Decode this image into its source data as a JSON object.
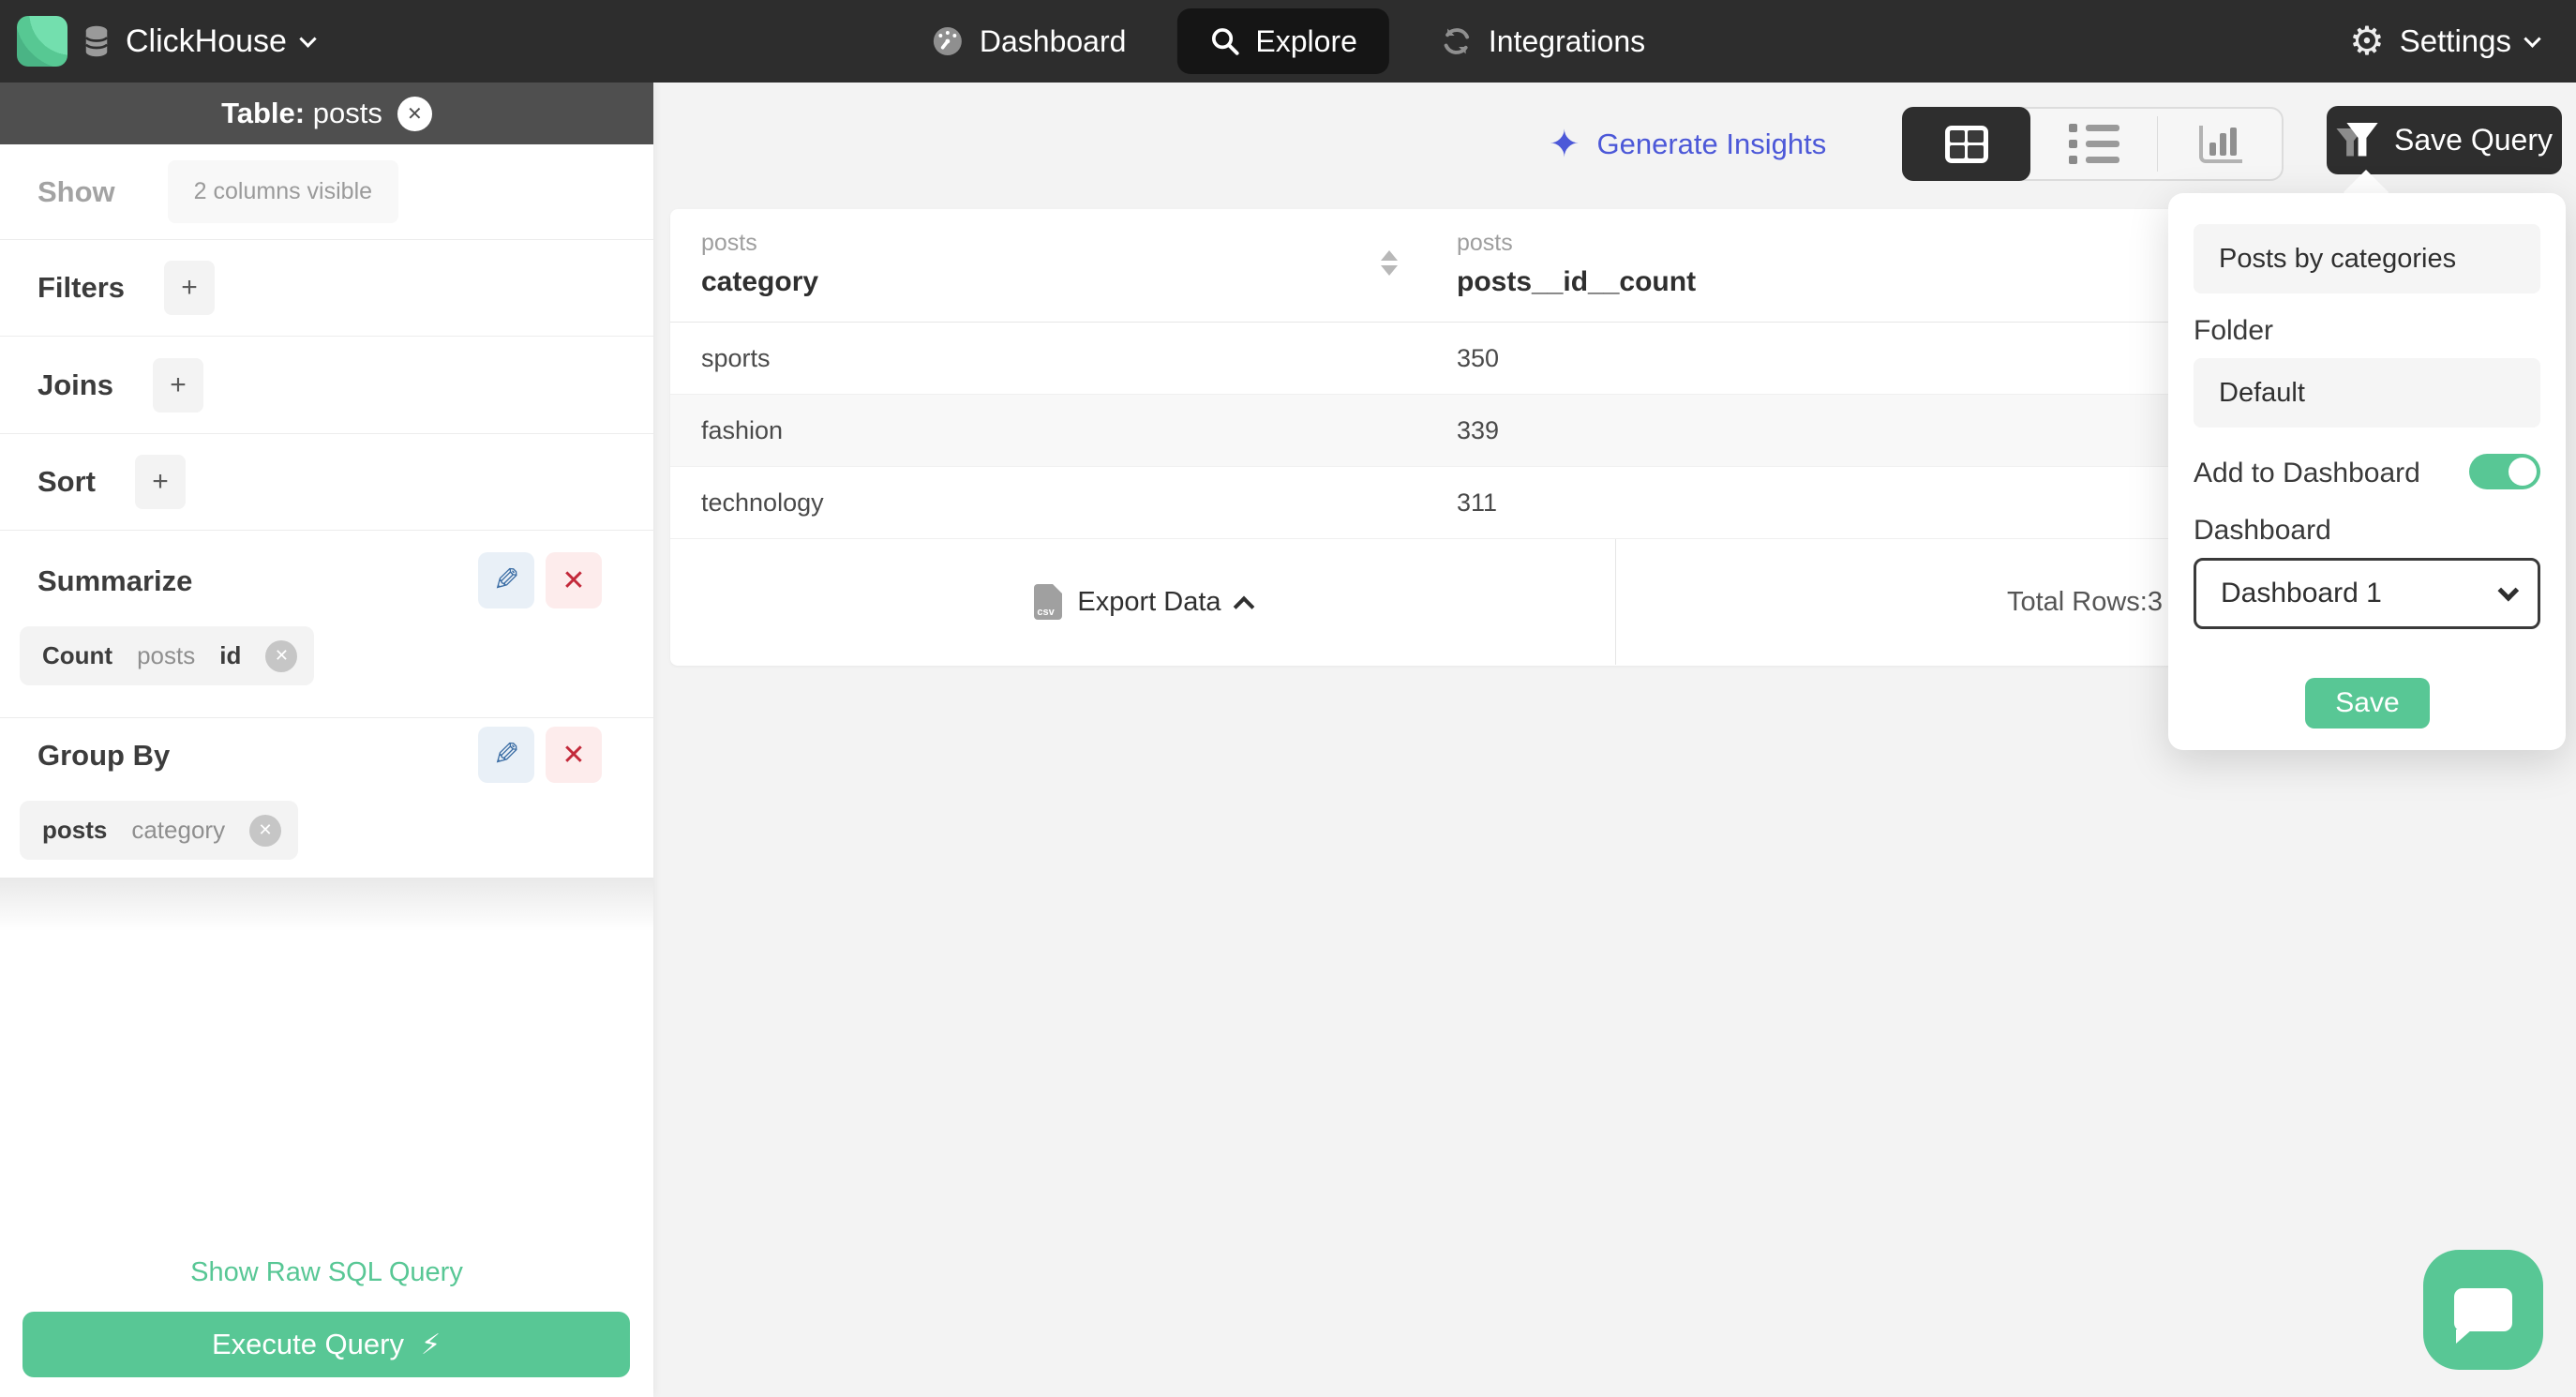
{
  "navbar": {
    "brand": {
      "name": "ClickHouse"
    },
    "tabs": [
      {
        "label": "Dashboard",
        "icon": "gauge-icon",
        "active": false
      },
      {
        "label": "Explore",
        "icon": "search-icon",
        "active": true
      },
      {
        "label": "Integrations",
        "icon": "sync-icon",
        "active": false
      }
    ],
    "settings_label": "Settings"
  },
  "sidebar": {
    "table_header": {
      "prefix": "Table:",
      "table": "posts"
    },
    "show": {
      "label": "Show",
      "button": "2 columns visible"
    },
    "filters": {
      "label": "Filters"
    },
    "joins": {
      "label": "Joins"
    },
    "sort": {
      "label": "Sort"
    },
    "summarize": {
      "label": "Summarize",
      "chip": {
        "agg": "Count",
        "table": "posts",
        "column": "id"
      }
    },
    "group_by": {
      "label": "Group By",
      "chip": {
        "table": "posts",
        "column": "category"
      }
    },
    "raw_sql_link": "Show Raw SQL Query",
    "execute_button": "Execute Query"
  },
  "main": {
    "generate_insights": "Generate Insights",
    "save_query_button": "Save Query",
    "table": {
      "columns": [
        {
          "group": "posts",
          "name": "category"
        },
        {
          "group": "posts",
          "name": "posts__id__count"
        }
      ],
      "rows": [
        {
          "category": "sports",
          "count": "350"
        },
        {
          "category": "fashion",
          "count": "339"
        },
        {
          "category": "technology",
          "count": "311"
        }
      ],
      "export_label": "Export Data",
      "export_icon_label": "csv",
      "total_rows_label": "Total Rows:",
      "total_rows_value": "3"
    }
  },
  "popover": {
    "name_value": "Posts by categories",
    "folder_label": "Folder",
    "folder_value": "Default",
    "add_to_dashboard_label": "Add to Dashboard",
    "add_to_dashboard_on": true,
    "dashboard_label": "Dashboard",
    "dashboard_selected": "Dashboard 1",
    "save_button": "Save"
  },
  "icons": {
    "sparkle": "✦",
    "lightning": "⚡",
    "gear": "⚙",
    "pencil": "✎",
    "close_x": "✕",
    "plus": "+"
  },
  "colors": {
    "accent_green": "#58c795",
    "link_blue": "#4c58d8",
    "danger_red": "#c3293a",
    "navbar_dark": "#2d2d2d",
    "sidebar_header_gray": "#4f4f4f",
    "page_bg": "#f3f3f3"
  }
}
